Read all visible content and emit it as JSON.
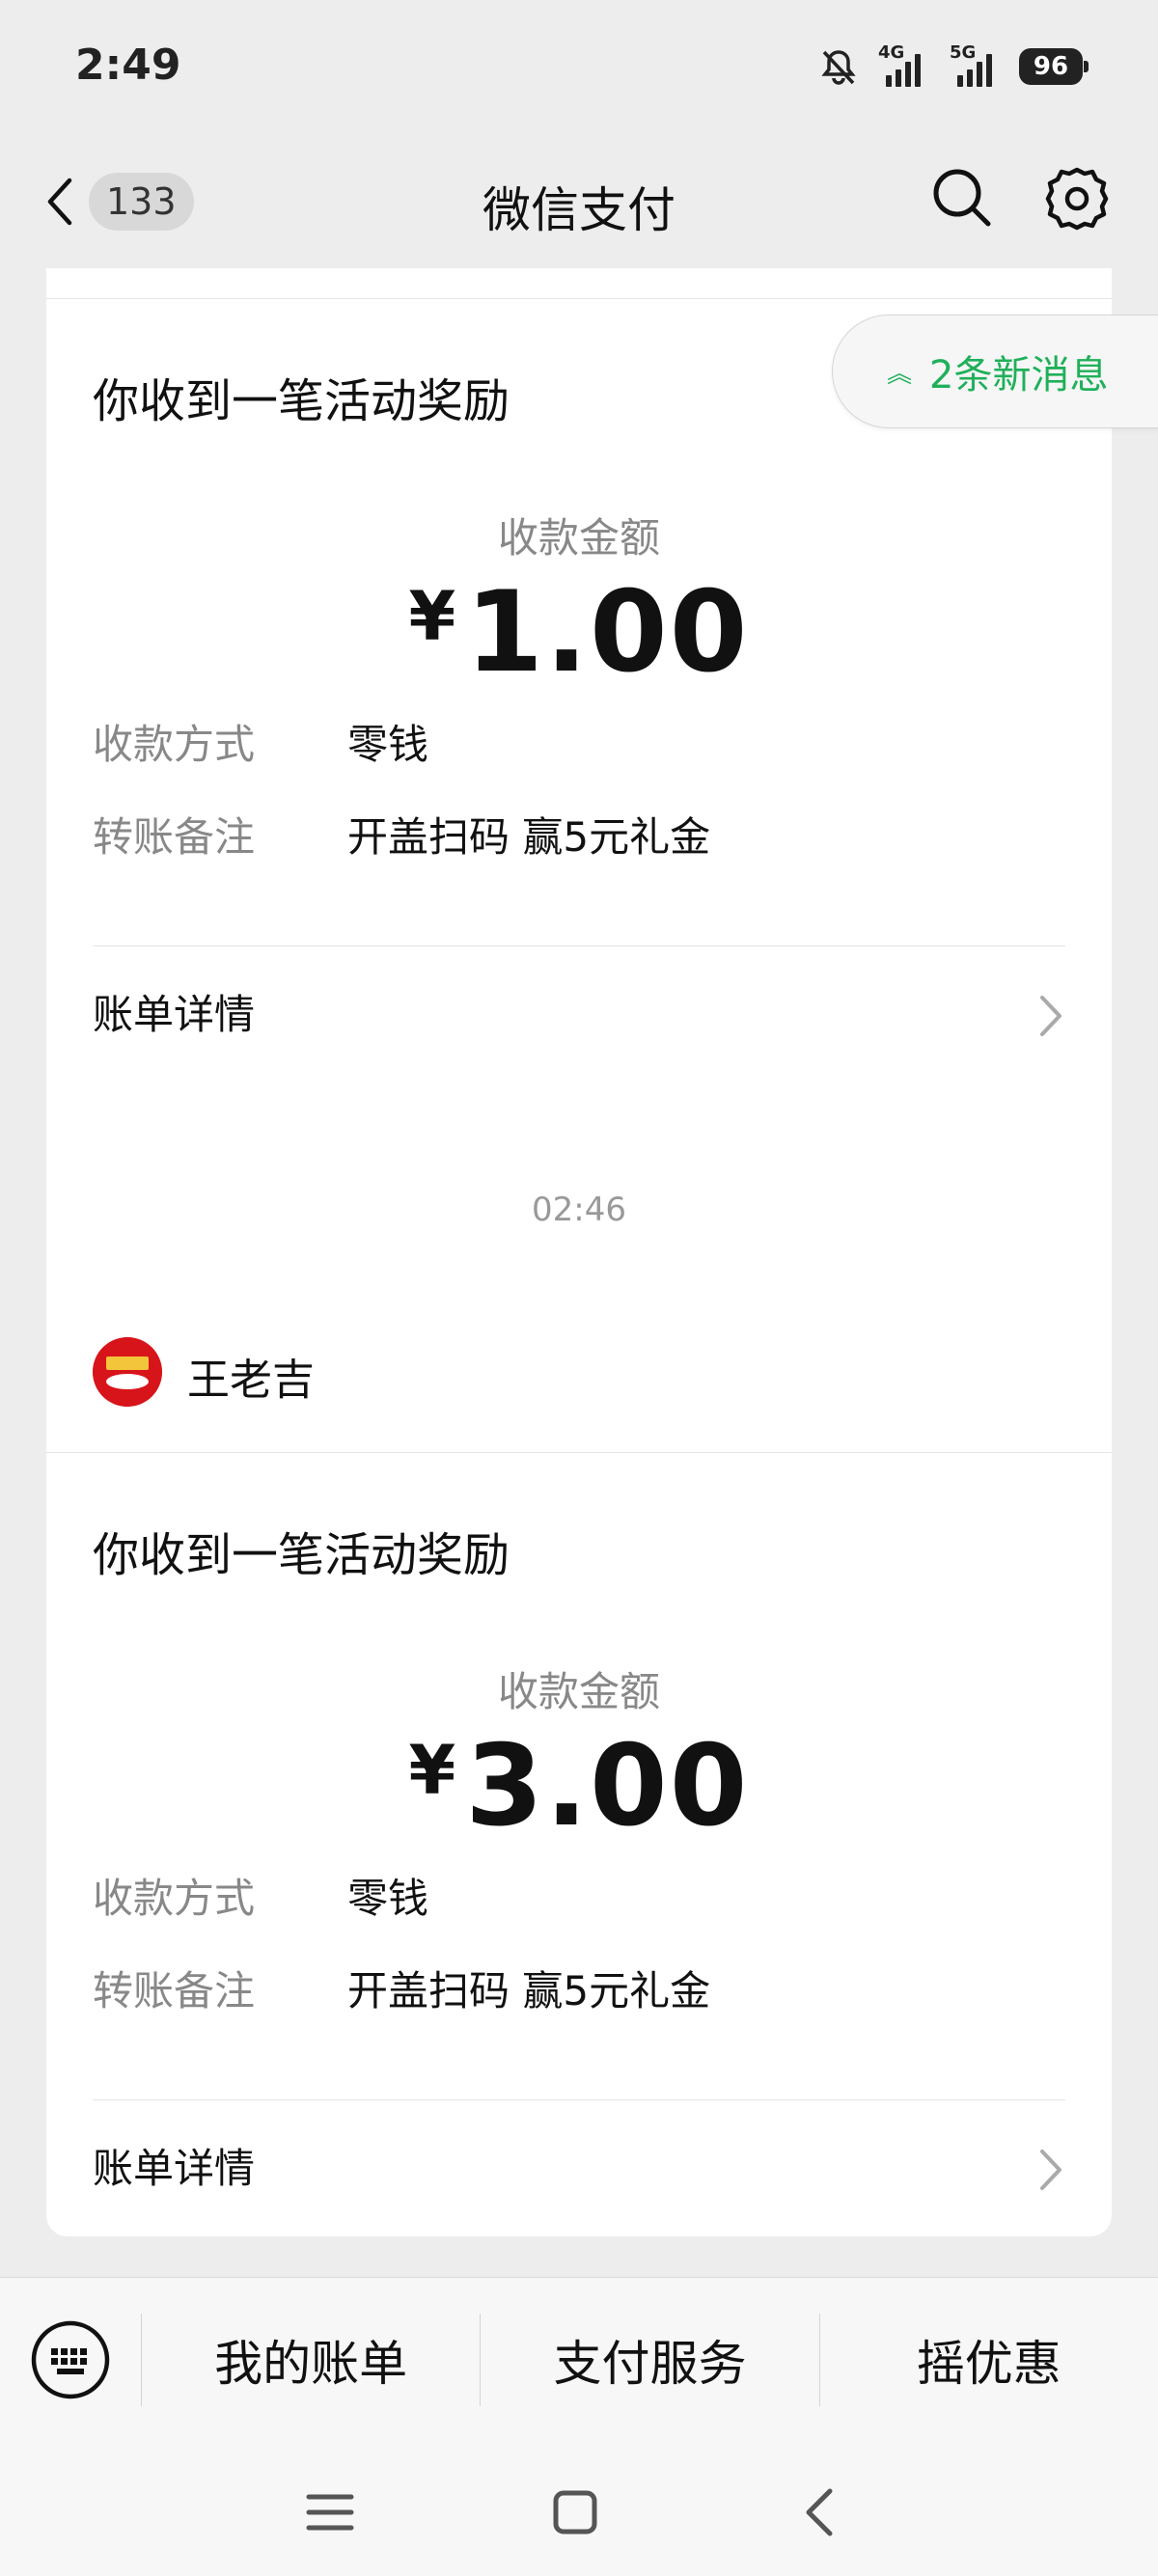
{
  "status_bar": {
    "time": "2:49",
    "network_1": "4G",
    "network_2": "5G",
    "battery": "96"
  },
  "nav": {
    "unread_count": "133",
    "title": "微信支付"
  },
  "new_messages_pill": "2条新消息",
  "cards": [
    {
      "title": "你收到一笔活动奖励",
      "amount_label": "收款金额",
      "currency": "¥",
      "amount": "1.00",
      "method_label": "收款方式",
      "method_value": "零钱",
      "note_label": "转账备注",
      "note_value": "开盖扫码 赢5元礼金",
      "detail_link": "账单详情"
    },
    {
      "merchant": "王老吉",
      "title": "你收到一笔活动奖励",
      "amount_label": "收款金额",
      "currency": "¥",
      "amount": "3.00",
      "method_label": "收款方式",
      "method_value": "零钱",
      "note_label": "转账备注",
      "note_value": "开盖扫码 赢5元礼金",
      "detail_link": "账单详情"
    }
  ],
  "timestamp": "02:46",
  "menu": {
    "items": [
      "我的账单",
      "支付服务",
      "摇优惠"
    ]
  },
  "colors": {
    "accent_green": "#20b05a",
    "merchant_red": "#d8141b",
    "background": "#ededed"
  }
}
